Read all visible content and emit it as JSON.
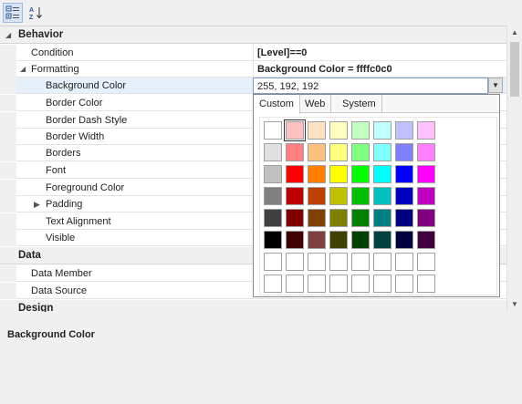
{
  "toolbar": {
    "buttons": [
      {
        "name": "categorized-view-button",
        "icon": "categorized-icon",
        "active": true
      },
      {
        "name": "alphabetical-sort-button",
        "icon": "sort-az-icon",
        "active": false
      }
    ]
  },
  "grid": {
    "categories": [
      {
        "label": "Behavior",
        "rows": [
          {
            "name": "Condition",
            "value": "[Level]==0",
            "bold_value": true
          },
          {
            "name": "Formatting",
            "value": "Background Color = ffffc0c0",
            "bold_value": true,
            "expanded": true
          },
          {
            "name": "Background Color",
            "value": "255, 192, 192",
            "bold_value": false,
            "selected": true
          },
          {
            "name": "Border Color",
            "value": ""
          },
          {
            "name": "Border Dash Style",
            "value": ""
          },
          {
            "name": "Border Width",
            "value": ""
          },
          {
            "name": "Borders",
            "value": ""
          },
          {
            "name": "Font",
            "value": ""
          },
          {
            "name": "Foreground Color",
            "value": ""
          },
          {
            "name": "Padding",
            "value": "",
            "collapsed": true
          },
          {
            "name": "Text Alignment",
            "value": ""
          },
          {
            "name": "Visible",
            "value": ""
          }
        ]
      },
      {
        "label": "Data",
        "rows": [
          {
            "name": "Data Member",
            "value": ""
          },
          {
            "name": "Data Source",
            "value": ""
          }
        ]
      },
      {
        "label": "Design",
        "rows": []
      }
    ]
  },
  "color_picker": {
    "tabs": [
      "Custom",
      "Web",
      "System"
    ],
    "active_tab": "Custom",
    "selected_color": "#ffc0c0",
    "swatches": [
      [
        "#ffffff",
        "#ffc0c0",
        "#ffe0c0",
        "#ffffc0",
        "#c0ffc0",
        "#c0ffff",
        "#c0c0ff",
        "#ffc0ff"
      ],
      [
        "#e0e0e0",
        "#ff8080",
        "#ffc080",
        "#ffff80",
        "#80ff80",
        "#80ffff",
        "#8080ff",
        "#ff80ff"
      ],
      [
        "#c0c0c0",
        "#ff0000",
        "#ff8000",
        "#ffff00",
        "#00ff00",
        "#00ffff",
        "#0000ff",
        "#ff00ff"
      ],
      [
        "#808080",
        "#c00000",
        "#c04000",
        "#c0c000",
        "#00c000",
        "#00c0c0",
        "#0000c0",
        "#c000c0"
      ],
      [
        "#404040",
        "#800000",
        "#804000",
        "#808000",
        "#008000",
        "#008080",
        "#000080",
        "#800080"
      ],
      [
        "#000000",
        "#400000",
        "#804040",
        "#404000",
        "#004000",
        "#004040",
        "#000040",
        "#400040"
      ],
      [
        "#ffffff",
        "#ffffff",
        "#ffffff",
        "#ffffff",
        "#ffffff",
        "#ffffff",
        "#ffffff",
        "#ffffff"
      ],
      [
        "#ffffff",
        "#ffffff",
        "#ffffff",
        "#ffffff",
        "#ffffff",
        "#ffffff",
        "#ffffff",
        "#ffffff"
      ]
    ]
  },
  "description": {
    "title": "Background Color",
    "text": ""
  },
  "splitter": {
    "grip": "....."
  }
}
